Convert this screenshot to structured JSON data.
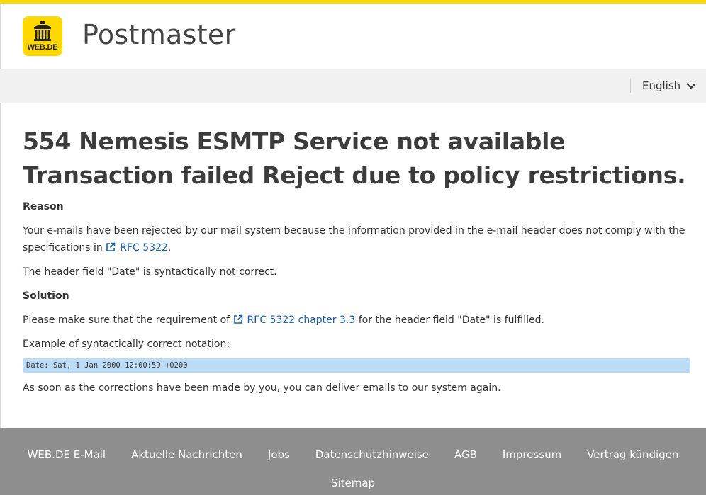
{
  "brand": {
    "logo_text": "WEB.DE",
    "title": "Postmaster",
    "colors": {
      "accent": "#ffd800",
      "link": "#1a5fa3",
      "footer": "#8e8e8e",
      "code_bg": "#bcdcf5"
    }
  },
  "language": {
    "label": "English",
    "icon": "chevron-down-icon"
  },
  "main": {
    "headline_line1": "554 Nemesis ESMTP Service not available",
    "headline_line2": "Transaction failed Reject due to policy restrictions.",
    "reason_title": "Reason",
    "reason_text_before": "Your e-mails have been rejected by our mail system because the information provided in the e-mail header does not comply with the specifications in",
    "reason_link": "RFC 5322",
    "reason_text_after": ".",
    "header_field_text": "The header field \"Date\" is syntactically not correct.",
    "solution_title": "Solution",
    "solution_text_before": "Please make sure that the requirement of",
    "solution_link": "RFC 5322 chapter 3.3",
    "solution_text_after": "for the header field \"Date\" is fulfilled.",
    "example_label": "Example of syntactically correct notation:",
    "example_code": "Date: Sat, 1 Jan 2000 12:00:59 +0200",
    "closing_text": "As soon as the corrections have been made by you, you can deliver emails to our system again."
  },
  "footer": {
    "links": [
      "WEB.DE E-Mail",
      "Aktuelle Nachrichten",
      "Jobs",
      "Datenschutzhinweise",
      "AGB",
      "Impressum",
      "Vertrag kündigen"
    ],
    "sitemap": "Sitemap"
  }
}
